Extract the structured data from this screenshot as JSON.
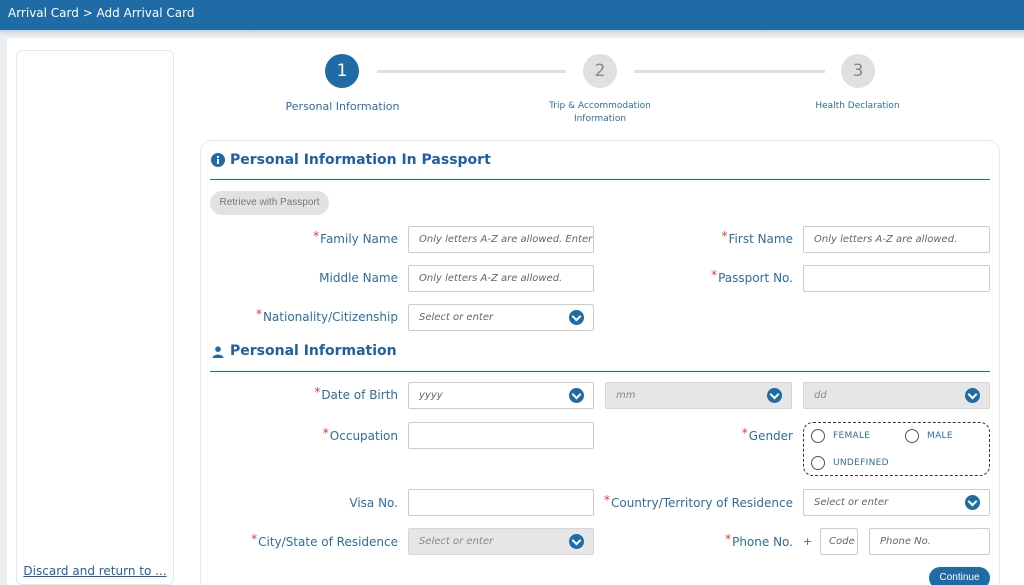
{
  "header": {
    "breadcrumb": "Arrival Card > Add Arrival Card"
  },
  "sidebar": {
    "discard_link": "Discard and return to ..."
  },
  "stepper": {
    "steps": [
      {
        "number": "1",
        "label": "Personal Information",
        "state": "active"
      },
      {
        "number": "2",
        "label": "Trip & Accommodation Information",
        "state": "inactive"
      },
      {
        "number": "3",
        "label": "Health Declaration",
        "state": "inactive"
      }
    ]
  },
  "passport_section": {
    "title": "Personal Information In Passport",
    "icon": "info-icon",
    "retrieve_button": "Retrieve with Passport",
    "fields": {
      "family_name": {
        "label": "Family Name",
        "required": "*",
        "placeholder": "Only letters A-Z are allowed. Enter ' if you have no family name"
      },
      "first_name": {
        "label": "First Name",
        "required": "*",
        "placeholder": "Only letters A-Z are allowed."
      },
      "middle_name": {
        "label": "Middle Name",
        "placeholder": "Only letters A-Z are allowed."
      },
      "passport_no": {
        "label": "Passport No.",
        "required": "*",
        "value": ""
      },
      "nationality": {
        "label": "Nationality/Citizenship",
        "required": "*",
        "placeholder": "Select or enter"
      }
    }
  },
  "personal_section": {
    "title": "Personal Information",
    "icon": "person-icon",
    "fields": {
      "dob": {
        "label": "Date of Birth",
        "required": "*",
        "year": "yyyy",
        "month": "mm",
        "day": "dd"
      },
      "occupation": {
        "label": "Occupation",
        "required": "*",
        "value": ""
      },
      "gender": {
        "label": "Gender",
        "required": "*",
        "options": [
          "FEMALE",
          "MALE",
          "UNDEFINED"
        ]
      },
      "visa_no": {
        "label": "Visa No.",
        "value": ""
      },
      "country_residence": {
        "label": "Country/Territory of Residence",
        "required": "*",
        "placeholder": "Select or enter"
      },
      "city_residence": {
        "label": "City/State of Residence",
        "required": "*",
        "placeholder": "Select or enter"
      },
      "phone": {
        "label": "Phone No.",
        "required": "*",
        "plus": "+",
        "code_placeholder": "Code",
        "number_placeholder": "Phone No."
      }
    }
  },
  "actions": {
    "continue": "Continue"
  },
  "colors": {
    "primary": "#1f6ba5",
    "required": "#e53935",
    "label": "#2e6da4"
  }
}
